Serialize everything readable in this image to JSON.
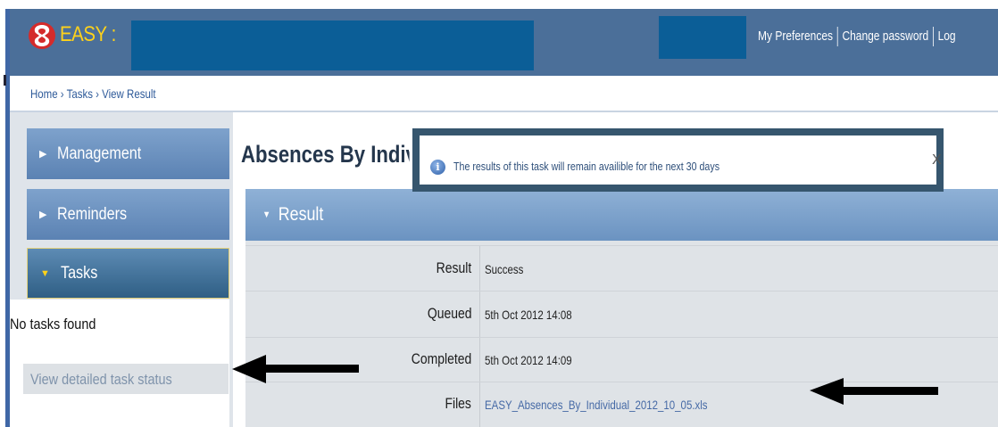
{
  "header": {
    "brand": "EASY :",
    "links": [
      "My Preferences",
      "Change password",
      "Log"
    ]
  },
  "breadcrumb": "Home › Tasks › View Result",
  "sidebar": {
    "items": [
      {
        "label": "Management",
        "state": "collapsed"
      },
      {
        "label": "Reminders",
        "state": "collapsed"
      },
      {
        "label": "Tasks",
        "state": "expanded"
      }
    ],
    "tasks_empty": "No tasks found",
    "view_status_link": "View detailed task status"
  },
  "main": {
    "title": "Absences By Individual",
    "notice": {
      "text": "The results of this task will remain availible for the next 30 days",
      "close": "X"
    },
    "result": {
      "header": "Result",
      "rows": [
        {
          "label": "Result",
          "value": "Success"
        },
        {
          "label": "Queued",
          "value": "5th Oct 2012 14:08"
        },
        {
          "label": "Completed",
          "value": "5th Oct 2012 14:09"
        },
        {
          "label": "Files",
          "value": "EASY_Absences_By_Individual_2012_10_05.xls"
        }
      ]
    }
  },
  "colors": {
    "header_bg": "#4b6f99",
    "brand": "#ffd21a",
    "redaction": "#0b5e97",
    "nav": "#6a90bf",
    "nav_active": "#3d6b92",
    "link": "#466aa6"
  }
}
